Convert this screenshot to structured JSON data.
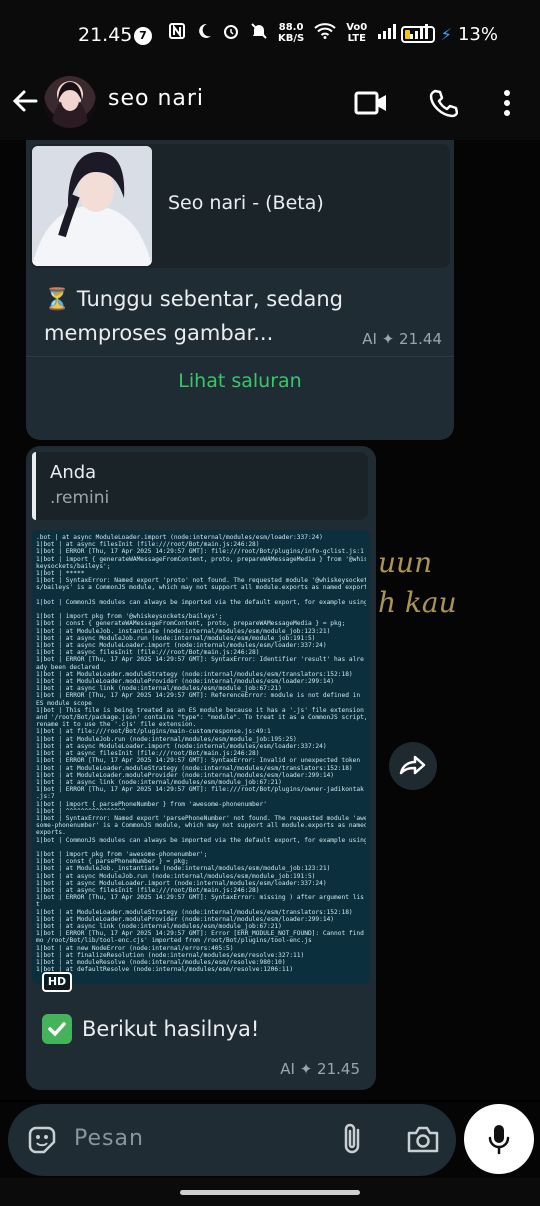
{
  "status_bar": {
    "time": "21.45",
    "notif_count": "7",
    "net_speed_value": "88.0",
    "net_speed_unit": "KB/S",
    "volte_top": "Vo0",
    "volte_bottom": "LTE",
    "battery": "13%"
  },
  "header": {
    "contact_name": "seo nari",
    "icons": [
      "back-arrow-icon",
      "video-call-icon",
      "voice-call-icon",
      "more-options-icon"
    ]
  },
  "background_text": {
    "line1": "uun",
    "line2": "h kau"
  },
  "message1": {
    "card_title": "Seo nari - (Beta)",
    "text_emoji": "⏳",
    "text": "Tunggu sebentar, sedang memproses gambar...",
    "meta_ai": "AI",
    "time": "21.44",
    "link_label": "Lihat saluran"
  },
  "message2": {
    "quote_author": "Anda",
    "quote_text": ".remini",
    "hd_label": "HD",
    "text": "Berikut hasilnya!",
    "meta_ai": "AI",
    "time": "21.45",
    "terminal_lines": [
      ".bot |       at async ModuleLoader.import (node:internal/modules/esm/loader:337:24)",
      "1|bot |       at async filesInit (file:///root/Bot/main.js:246:28)",
      "1|bot |   ERROR  [Thu, 17 Apr 2025 14:29:57 GMT]: file:///root/Bot/plugins/info-gclist.js:1",
      "1|bot |   import { generateWAMessageFromContent, proto, prepareWAMessageMedia } from '@whis",
      "keysockets/baileys';",
      "1|bot |                                                              *****",
      "1|bot |   SyntaxError: Named export 'proto' not found. The requested module '@whiskeysocket",
      "s/baileys' is a CommonJS module, which may not support all module.exports as named exports",
      "",
      "1|bot |   CommonJS modules can always be imported via the default export, for example using",
      "",
      "1|bot |   import pkg from '@whiskeysockets/baileys';",
      "1|bot |   const { generateWAMessageFromContent, proto, prepareWAMessageMedia } = pkg;",
      "1|bot |       at ModuleJob._instantiate (node:internal/modules/esm/module_job:123:21)",
      "1|bot |       at async ModuleJob.run (node:internal/modules/esm/module_job:191:5)",
      "1|bot |       at async ModuleLoader.import (node:internal/modules/esm/loader:337:24)",
      "1|bot |       at async filesInit (file:///root/Bot/main.js:246:28)",
      "1|bot |   ERROR  [Thu, 17 Apr 2025 14:29:57 GMT]: SyntaxError: Identifier 'result' has alre",
      "ady been declared",
      "1|bot |       at ModuleLoader.moduleStrategy (node:internal/modules/esm/translators:152:18)",
      "1|bot |       at ModuleLoader.moduleProvider (node:internal/modules/esm/loader:299:14)",
      "1|bot |       at async link (node:internal/modules/esm/module_job:67:21)",
      "1|bot |   ERROR  [Thu, 17 Apr 2025 14:29:57 GMT]: ReferenceError: module is not defined in",
      "ES module scope",
      "1|bot |   This file is being treated as an ES module because it has a '.js' file extension",
      "and '/root/Bot/package.json' contains \"type\": \"module\". To treat it as a CommonJS script,",
      "rename it to use the '.cjs' file extension.",
      "1|bot |       at file:///root/Bot/plugins/main-customresponse.js:49:1",
      "1|bot |       at ModuleJob.run (node:internal/modules/esm/module_job:195:25)",
      "1|bot |       at async ModuleLoader.import (node:internal/modules/esm/loader:337:24)",
      "1|bot |       at async filesInit (file:///root/Bot/main.js:246:28)",
      "1|bot |   ERROR  [Thu, 17 Apr 2025 14:29:57 GMT]: SyntaxError: Invalid or unexpected token",
      "1|bot |       at ModuleLoader.moduleStrategy (node:internal/modules/esm/translators:152:18)",
      "1|bot |       at ModuleLoader.moduleProvider (node:internal/modules/esm/loader:299:14)",
      "1|bot |       at async link (node:internal/modules/esm/module_job:67:21)",
      "1|bot |   ERROR  [Thu, 17 Apr 2025 14:29:57 GMT]: file:///root/Bot/plugins/owner-jadikontak",
      ".js:7",
      "1|bot |   import { parsePhoneNumber } from 'awesome-phonenumber'",
      "1|bot |            ^^^^^^^^^^^^^^^^",
      "1|bot |   SyntaxError: Named export 'parsePhoneNumber' not found. The requested module 'awe",
      "some-phonenumber' is a CommonJS module, which may not support all module.exports as named",
      "exports.",
      "1|bot |   CommonJS modules can always be imported via the default export, for example using",
      "",
      "1|bot |   import pkg from 'awesome-phonenumber';",
      "1|bot |   const { parsePhoneNumber } = pkg;",
      "1|bot |       at ModuleJob._instantiate (node:internal/modules/esm/module_job:123:21)",
      "1|bot |       at async ModuleJob.run (node:internal/modules/esm/module_job:191:5)",
      "1|bot |       at async ModuleLoader.import (node:internal/modules/esm/loader:337:24)",
      "1|bot |       at async filesInit (file:///root/Bot/main.js:246:28)",
      "1|bot |   ERROR  [Thu, 17 Apr 2025 14:29:57 GMT]: SyntaxError: missing ) after argument lis",
      "t",
      "1|bot |       at ModuleLoader.moduleStrategy (node:internal/modules/esm/translators:152:18)",
      "1|bot |       at ModuleLoader.moduleProvider (node:internal/modules/esm/loader:299:14)",
      "1|bot |       at async link (node:internal/modules/esm/module_job:67:21)",
      "1|bot |   ERROR  [Thu, 17 Apr 2025 14:29:57 GMT]: Error [ERR_MODULE_NOT_FOUND]: Cannot find",
      "mo  /root/Bot/lib/tool-enc.cjs' imported from /root/Bot/plugins/tool-enc.js",
      "1|bot |       at new NodeError (node:internal/errors:405:5)",
      "1|bot |       at finalizeResolution (node:internal/modules/esm/resolve:327:11)",
      "1|bot |       at moduleResolve (node:internal/modules/esm/resolve:980:10)",
      "1|bot |       at defaultResolve (node:internal/modules/esm/resolve:1206:11)"
    ]
  },
  "composer": {
    "placeholder": "Pesan"
  }
}
